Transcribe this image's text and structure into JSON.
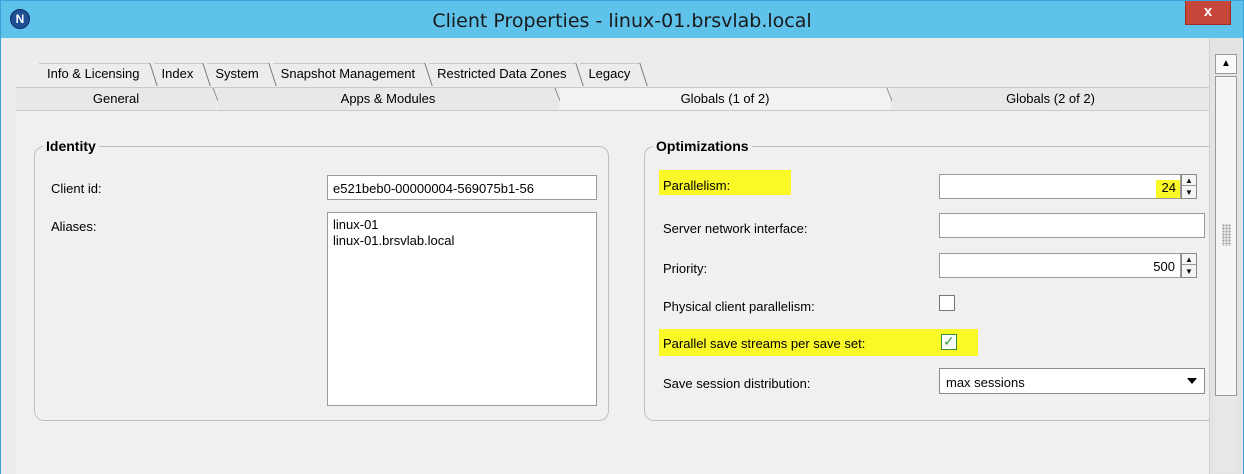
{
  "window": {
    "title": "Client Properties - linux-01.brsvlab.local",
    "logo_letter": "N",
    "close_label": "x"
  },
  "tabs_row1": [
    {
      "label": "Info & Licensing"
    },
    {
      "label": "Index"
    },
    {
      "label": "System"
    },
    {
      "label": "Snapshot Management"
    },
    {
      "label": "Restricted Data Zones"
    },
    {
      "label": "Legacy"
    }
  ],
  "tabs_row2": [
    {
      "label": "General",
      "active": false
    },
    {
      "label": "Apps & Modules",
      "active": false
    },
    {
      "label": "Globals (1 of 2)",
      "active": true
    },
    {
      "label": "Globals (2 of 2)",
      "active": false
    }
  ],
  "identity": {
    "title": "Identity",
    "client_id_label": "Client id:",
    "client_id_value": "e521beb0-00000004-569075b1-56",
    "aliases_label": "Aliases:",
    "aliases": [
      "linux-01",
      "linux-01.brsvlab.local"
    ]
  },
  "optimizations": {
    "title": "Optimizations",
    "parallelism_label": "Parallelism:",
    "parallelism_value": "24",
    "server_nic_label": "Server network interface:",
    "server_nic_value": "",
    "priority_label": "Priority:",
    "priority_value": "500",
    "physical_parallelism_label": "Physical client parallelism:",
    "physical_parallelism_checked": false,
    "parallel_streams_label": "Parallel save streams per save set:",
    "parallel_streams_checked": true,
    "save_session_label": "Save session distribution:",
    "save_session_value": "max sessions"
  },
  "colors": {
    "titlebar": "#5fc2ea",
    "highlight": "#faf827",
    "close": "#c7463a",
    "check": "#37a13a"
  },
  "icons": {
    "logo": "networker-logo-icon",
    "close": "close-icon",
    "spin_up": "arrow-up-icon",
    "spin_down": "arrow-down-icon",
    "dropdown": "chevron-down-icon",
    "check": "check-icon"
  }
}
